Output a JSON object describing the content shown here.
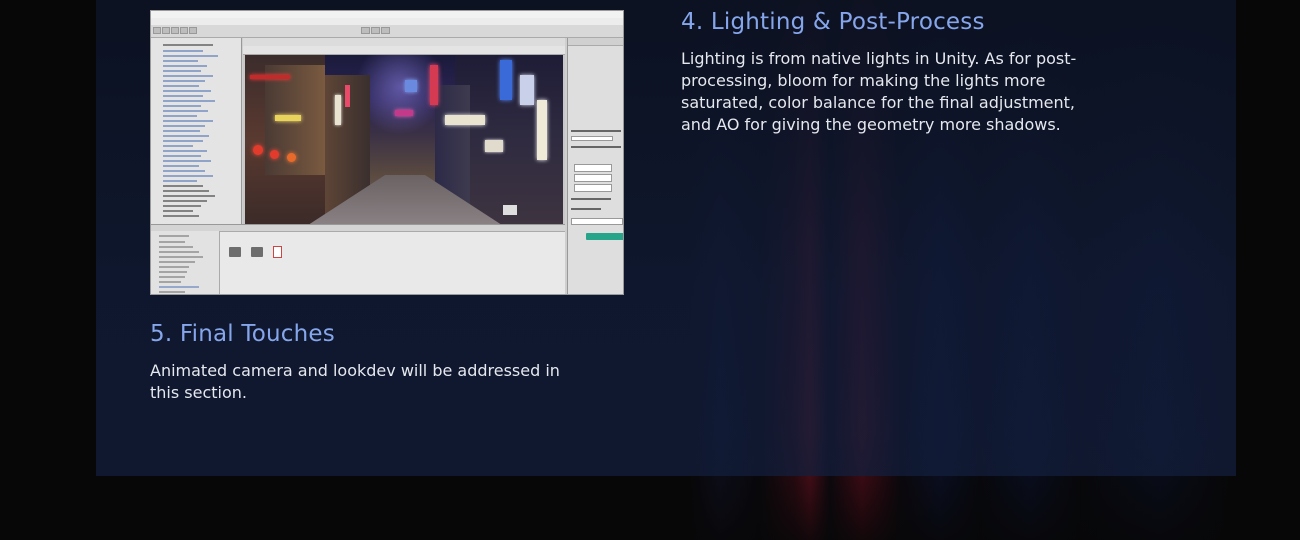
{
  "sections": [
    {
      "heading": "4. Lighting & Post-Process",
      "body": "Lighting is from native lights in Unity. As for post-processing, bloom for making the lights more saturated, color balance for the final adjustment, and AO for giving the geometry more shadows."
    },
    {
      "heading": "5. Final Touches",
      "body": "Animated camera and lookdev will be addressed in this section."
    }
  ],
  "screenshot": {
    "description_icon": "unity-editor-screenshot",
    "accent_colors": {
      "heading": "#86a6ec",
      "neon_red": "#d0203a",
      "neon_blue": "#2a4fb0"
    }
  }
}
